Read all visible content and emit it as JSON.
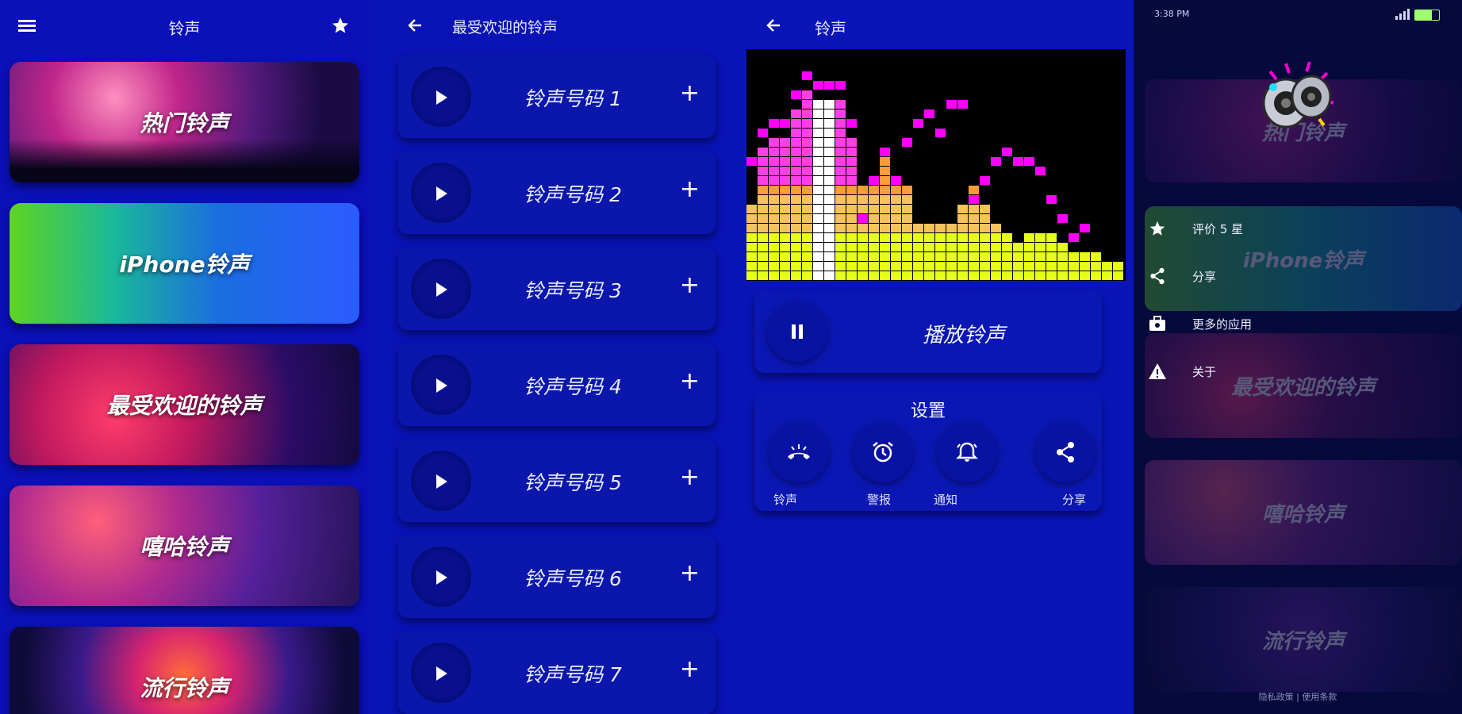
{
  "home": {
    "title": "铃声",
    "categories": [
      {
        "label": "热门铃声"
      },
      {
        "label": "iPhone铃声"
      },
      {
        "label": "最受欢迎的铃声"
      },
      {
        "label": "嘻哈铃声"
      },
      {
        "label": "流行铃声"
      }
    ],
    "icons": {
      "menu": "hamburger-icon",
      "favorite": "star-icon"
    }
  },
  "list": {
    "title": "最受欢迎的铃声",
    "items": [
      {
        "label": "铃声号码 1"
      },
      {
        "label": "铃声号码 2"
      },
      {
        "label": "铃声号码 3"
      },
      {
        "label": "铃声号码 4"
      },
      {
        "label": "铃声号码 5"
      },
      {
        "label": "铃声号码 6"
      },
      {
        "label": "铃声号码 7"
      }
    ]
  },
  "player": {
    "title": "铃声",
    "play_label": "播放铃声",
    "settings_title": "设置",
    "actions": [
      {
        "label": "铃声",
        "icon": "ringtone-icon"
      },
      {
        "label": "警报",
        "icon": "alarm-icon"
      },
      {
        "label": "通知",
        "icon": "notification-icon"
      },
      {
        "label": "分享",
        "icon": "share-icon"
      }
    ],
    "equalizer_levels": [
      8,
      10,
      10,
      10,
      10,
      10,
      13,
      13,
      10,
      10,
      10,
      10,
      13,
      10,
      10,
      6,
      6,
      6,
      6,
      8,
      10,
      8,
      6,
      5,
      4,
      5,
      5,
      5,
      4,
      3,
      3,
      3,
      2,
      2
    ],
    "equalizer_peaks": [
      12,
      15,
      16,
      16,
      19,
      21,
      20,
      20,
      20,
      16,
      6,
      10,
      13,
      10,
      14,
      16,
      17,
      15,
      18,
      18,
      8,
      10,
      12,
      13,
      12,
      12,
      11,
      8,
      6,
      4,
      5
    ]
  },
  "drawer": {
    "status_time": "3:38 PM",
    "menu": [
      {
        "label": "评价 5 星",
        "icon": "star-icon"
      },
      {
        "label": "分享",
        "icon": "share-icon"
      },
      {
        "label": "更多的应用",
        "icon": "store-icon"
      },
      {
        "label": "关于",
        "icon": "warning-icon"
      }
    ],
    "bg_cards": [
      "热门铃声",
      "iPhone铃声",
      "最受欢迎的铃声",
      "嘻哈铃声",
      "流行铃声"
    ],
    "footer": "隐私政策 | 使用条款"
  },
  "colors": {
    "accent": "#0a12b4",
    "dark": "#05093b",
    "magenta": "#ff00ff",
    "yellow": "#e4ff00"
  }
}
